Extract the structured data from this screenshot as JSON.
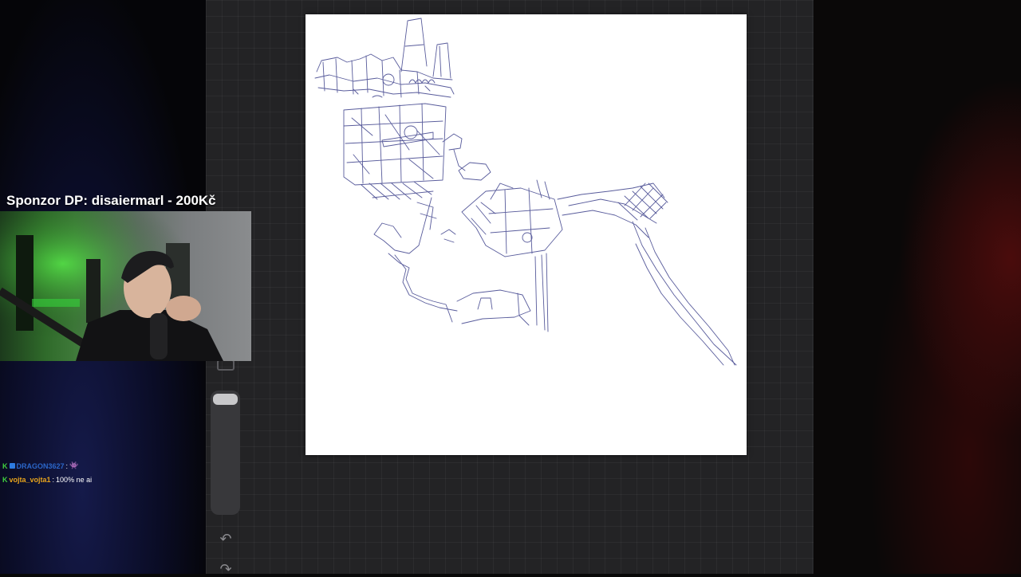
{
  "sponsor": {
    "text": "Sponzor DP: disaiermarl - 200Kč"
  },
  "chat": {
    "messages": [
      {
        "badge": "K",
        "user": "DRAGON3627",
        "separator": ":",
        "text": "👾"
      },
      {
        "badge": "K",
        "user": "vojta_vojta1",
        "separator": ":",
        "text": "100% ne ai"
      }
    ]
  },
  "toolbar": {
    "undo_icon": "undo-icon",
    "redo_icon": "redo-icon",
    "modify_icon": "square-icon"
  },
  "colors": {
    "canvas": "#ffffff",
    "app_background": "#232325",
    "sketch_ink": "#3b3f8a",
    "chat_user1": "#2b66c8",
    "chat_user2": "#e8a41c"
  }
}
